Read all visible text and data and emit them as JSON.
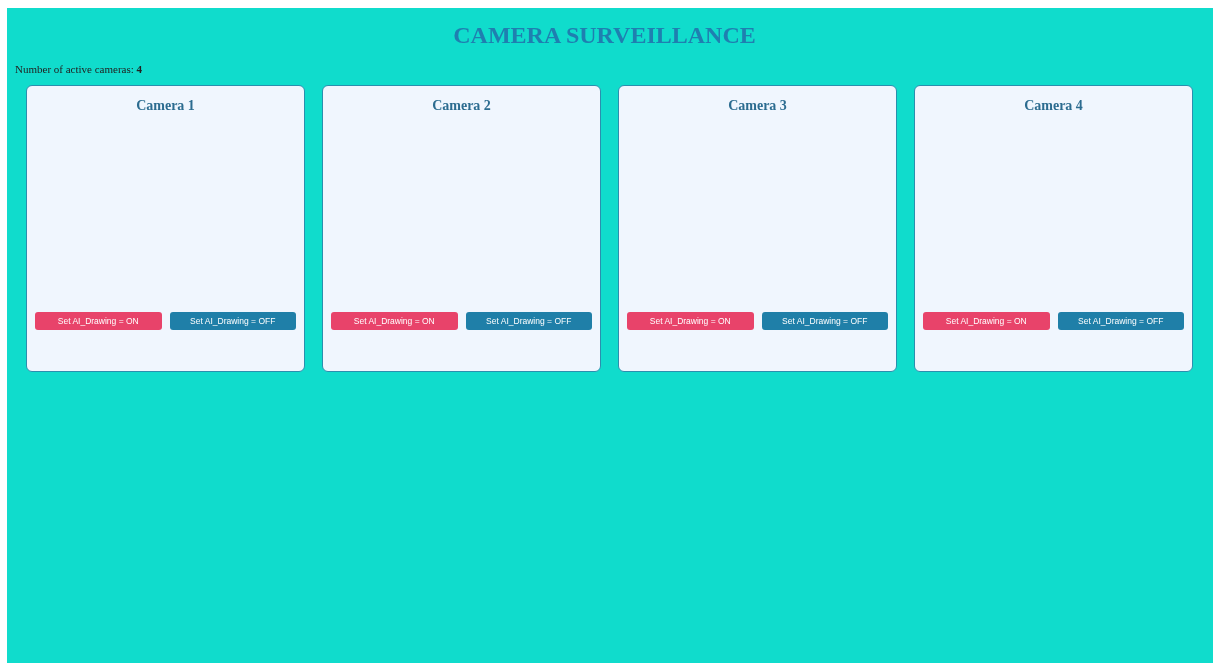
{
  "title": "CAMERA SURVEILLANCE",
  "active_count": {
    "label": "Number of active cameras:",
    "value": "4"
  },
  "cameras": [
    {
      "name": "Camera 1",
      "buttons": [
        {
          "label": "Set AI_Drawing = ON",
          "kind": "on"
        },
        {
          "label": "Set AI_Drawing = OFF",
          "kind": "off"
        }
      ]
    },
    {
      "name": "Camera 2",
      "buttons": [
        {
          "label": "Set AI_Drawing = ON",
          "kind": "on"
        },
        {
          "label": "Set AI_Drawing = OFF",
          "kind": "off"
        }
      ]
    },
    {
      "name": "Camera 3",
      "buttons": [
        {
          "label": "Set AI_Drawing = ON",
          "kind": "on"
        },
        {
          "label": "Set AI_Drawing = OFF",
          "kind": "off"
        }
      ]
    },
    {
      "name": "Camera 4",
      "buttons": [
        {
          "label": "Set AI_Drawing = ON",
          "kind": "on"
        },
        {
          "label": "Set AI_Drawing = OFF",
          "kind": "off"
        }
      ]
    }
  ]
}
